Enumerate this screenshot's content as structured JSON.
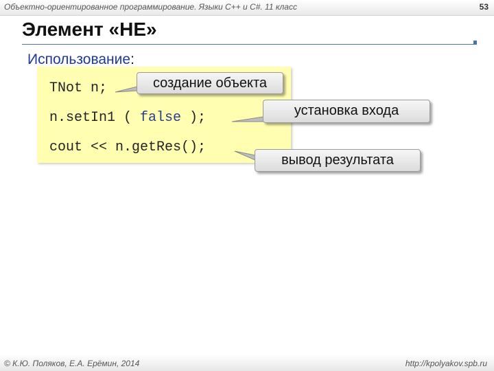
{
  "header": {
    "course_title": "Объектно-ориентированное программирование. Языки C++ и C#. 11 класс",
    "page_number": "53"
  },
  "slide": {
    "title": "Элемент «НЕ»",
    "usage_label": "Использование",
    "usage_colon": ":"
  },
  "code": {
    "line1": "TNot n;",
    "line2_prefix": "n.setIn1 ( ",
    "line2_keyword": "false",
    "line2_suffix": " );",
    "line3": "cout << n.getRes();"
  },
  "callouts": {
    "create_object": "создание объекта",
    "set_input": "установка входа",
    "output_result": "вывод результата"
  },
  "footer": {
    "authors": "© К.Ю. Поляков, Е.А. Ерёмин, 2014",
    "url": "http://kpolyakov.spb.ru"
  },
  "colors": {
    "code_background": "#fffeb1",
    "keyword": "#2a3c8f",
    "rule": "#4d6fae"
  }
}
